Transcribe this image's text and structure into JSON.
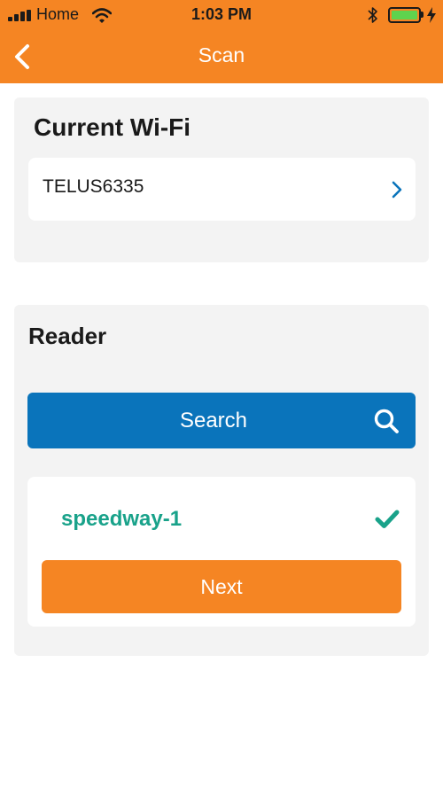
{
  "status_bar": {
    "carrier": "Home",
    "time": "1:03 PM",
    "battery_level": 1.0
  },
  "header": {
    "title": "Scan",
    "back_icon": "chevron-left-icon",
    "background_color": "#f58523"
  },
  "current_wifi": {
    "title": "Current Wi-Fi",
    "network_name": "TELUS6335",
    "chevron_icon": "chevron-right-icon"
  },
  "reader": {
    "title": "Reader",
    "search_label": "Search",
    "search_icon": "search-icon",
    "search_color": "#0a74bb",
    "device_name": "speedway-1",
    "device_selected": true,
    "device_color": "#19a28a",
    "next_label": "Next",
    "next_color": "#f58523"
  }
}
